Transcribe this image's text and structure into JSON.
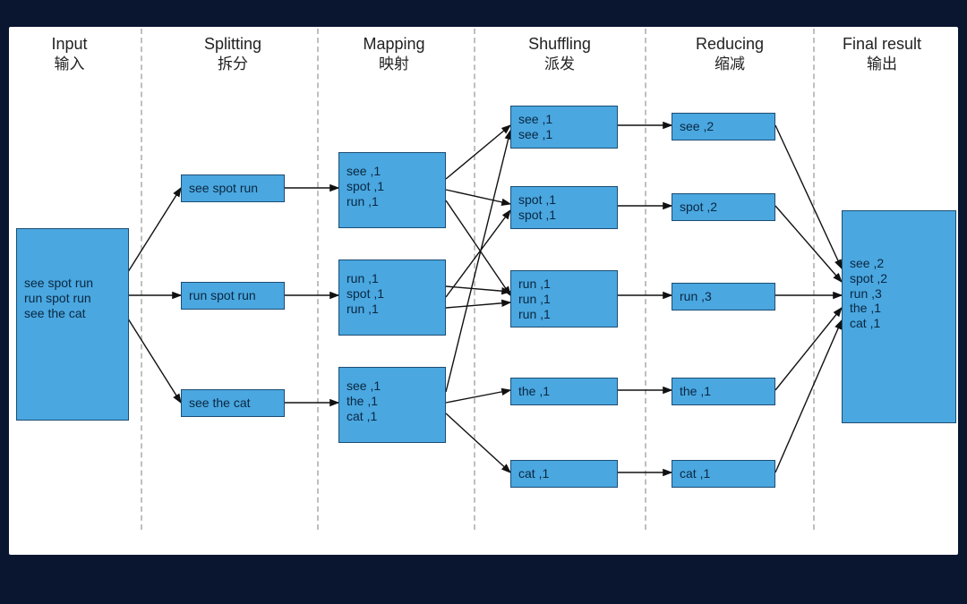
{
  "columns": [
    {
      "en": "Input",
      "cn": "输入"
    },
    {
      "en": "Splitting",
      "cn": "拆分"
    },
    {
      "en": "Mapping",
      "cn": "映射"
    },
    {
      "en": "Shuffling",
      "cn": "派发"
    },
    {
      "en": "Reducing",
      "cn": "缩减"
    },
    {
      "en": "Final result",
      "cn": "输出"
    }
  ],
  "boxes": {
    "input": "see spot run\nrun spot run\nsee the cat",
    "split": [
      "see spot run",
      "run spot run",
      "see the cat"
    ],
    "map": [
      "see ,1\nspot ,1\nrun ,1",
      "run ,1\nspot ,1\nrun ,1",
      "see ,1\nthe ,1\ncat ,1"
    ],
    "shuffle": [
      "see ,1\nsee ,1",
      "spot ,1\nspot ,1",
      "run ,1\nrun ,1\nrun ,1",
      "the ,1",
      "cat ,1"
    ],
    "reduce": [
      "see ,2",
      "spot ,2",
      "run ,3",
      "the ,1",
      "cat ,1"
    ],
    "final": "see ,2\nspot ,2\nrun ,3\nthe ,1\ncat ,1"
  }
}
